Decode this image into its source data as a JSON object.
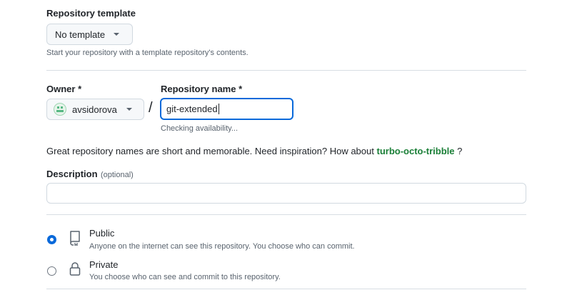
{
  "template": {
    "label": "Repository template",
    "selected": "No template",
    "help": "Start your repository with a template repository's contents."
  },
  "owner": {
    "label": "Owner *",
    "selected": "avsidorova",
    "separator": "/"
  },
  "repo_name": {
    "label": "Repository name *",
    "value": "git-extended",
    "status": "Checking availability..."
  },
  "suggestion": {
    "text": "Great repository names are short and memorable. Need inspiration? How about",
    "name": "turbo-octo-tribble",
    "suffix": "?"
  },
  "description": {
    "label": "Description",
    "optional": "(optional)",
    "value": ""
  },
  "visibility": {
    "public": {
      "label": "Public",
      "help": "Anyone on the internet can see this repository. You choose who can commit.",
      "checked": true
    },
    "private": {
      "label": "Private",
      "help": "You choose who can see and commit to this repository.",
      "checked": false
    }
  },
  "colors": {
    "accent": "#0969da",
    "suggestion": "#1a7f37"
  }
}
